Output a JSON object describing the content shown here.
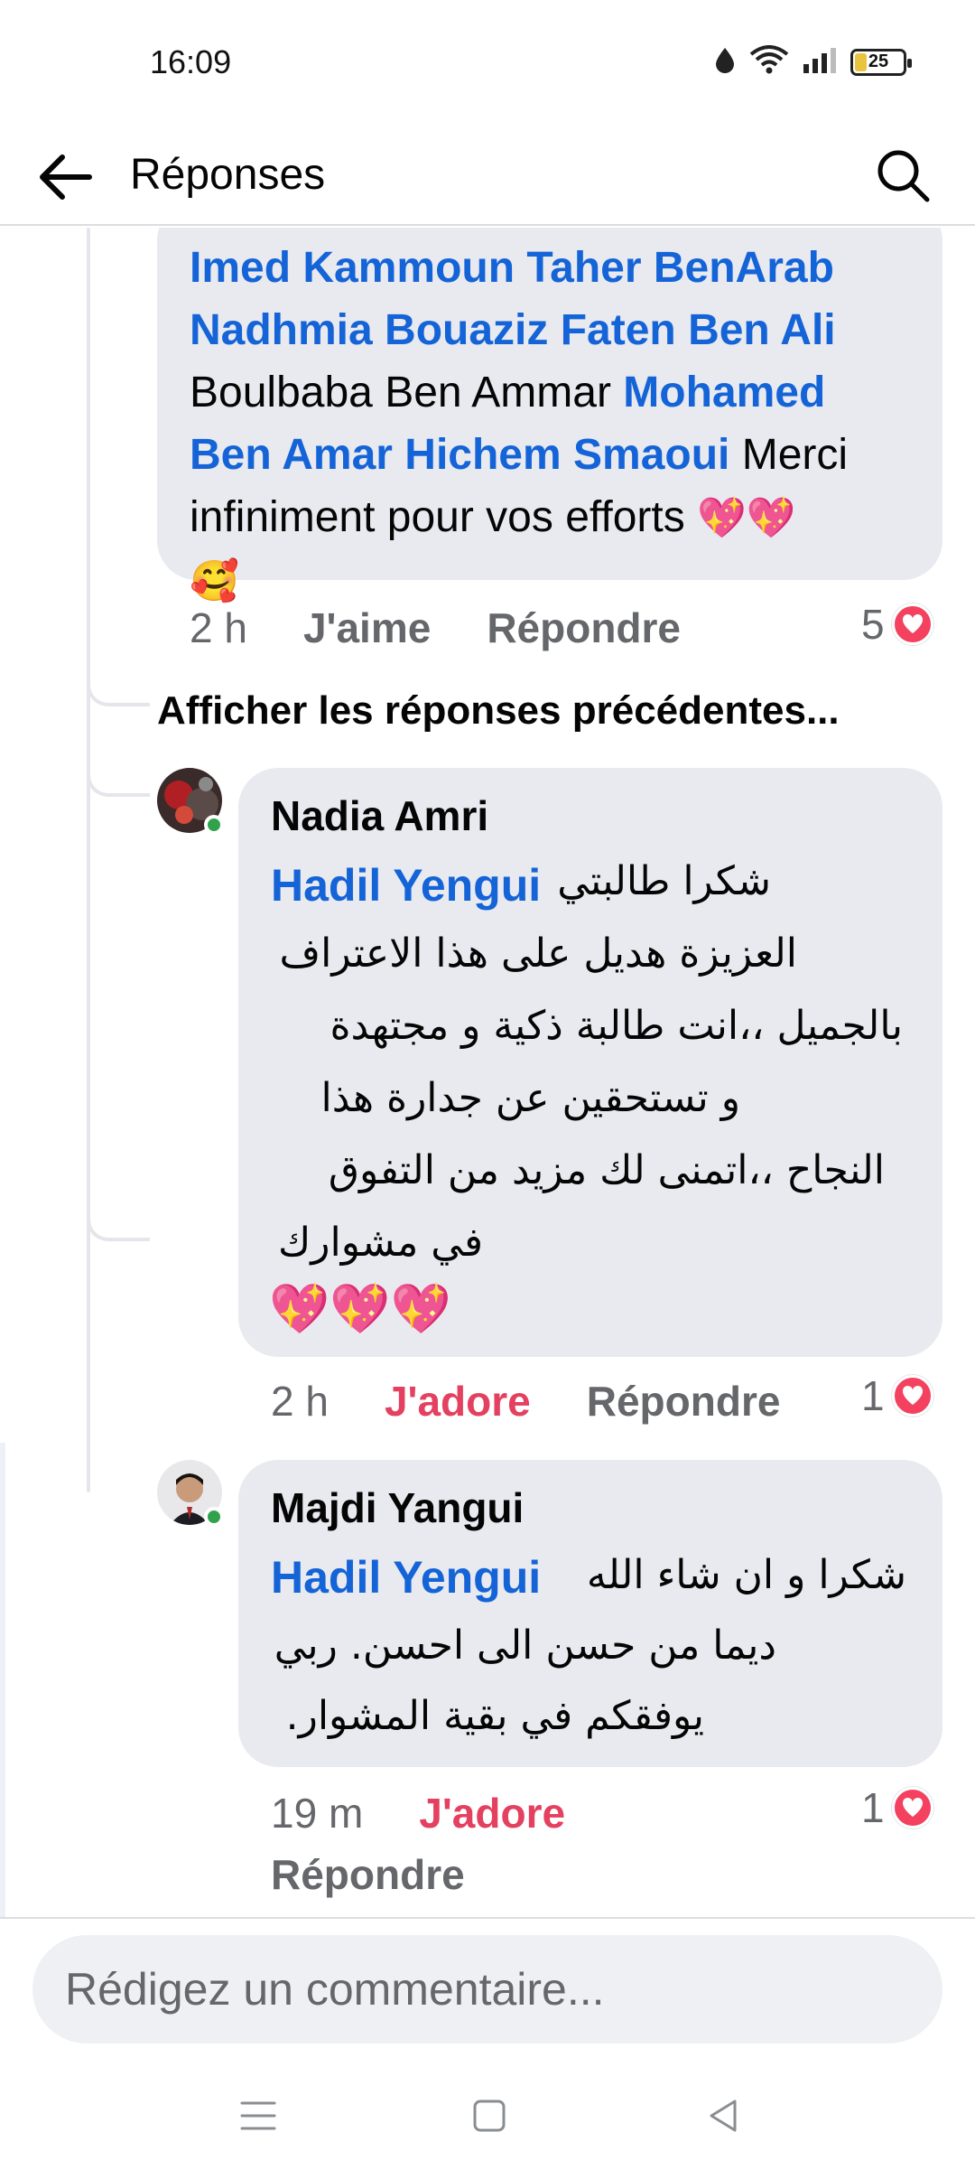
{
  "status_bar": {
    "time": "16:09",
    "battery": "25",
    "battery_level": 0.25
  },
  "app_bar": {
    "title": "Réponses",
    "back_icon": "arrow-left-icon",
    "search_icon": "search-icon"
  },
  "comment1": {
    "line1": "Imed Kammoun Taher BenArab",
    "line2": "Nadhmia Bouaziz Faten Ben Ali",
    "line3_plain": "Boulbaba Ben Ammar ",
    "line3_mention": "Mohamed",
    "line4_mention": "Ben Amar Hichem Smaoui",
    "line4_plain": " Merci",
    "line5": "infiniment pour vos efforts ",
    "emojis_line5": "💖💖",
    "emoji_line6": "🥰",
    "time": "2 h",
    "like": "J'aime",
    "reply": "Répondre",
    "reaction_count": "5"
  },
  "previous_replies": "Afficher les réponses précédentes...",
  "comment2": {
    "author": "Nadia Amri",
    "mention": "Hadil Yengui",
    "line1": "شكرا طالبتي",
    "line2": "العزيزة هديل على هذا الاعتراف",
    "line3": "بالجميل ،،انت طالبة ذكية و مجتهدة",
    "line4": "و تستحقين عن جدارة هذا",
    "line5": "النجاح ،،اتمنى لك مزيد من التفوق",
    "line6": "في مشوارك",
    "emojis": "💖💖💖",
    "time": "2 h",
    "reaction_label": "J'adore",
    "reply": "Répondre",
    "reaction_count": "1"
  },
  "comment3": {
    "author": "Majdi Yangui",
    "mention": "Hadil Yengui",
    "line1": "شكرا و ان شاء الله",
    "line2": "ديما من حسن الى احسن. ربي",
    "line3": "يوفقكم في بقية المشوار.",
    "time": "19 m",
    "reaction_label": "J'adore",
    "reply": "Répondre",
    "reaction_count": "1"
  },
  "composer": {
    "placeholder": "Rédigez un commentaire..."
  },
  "nav": {
    "menu_icon": "menu-icon",
    "home_icon": "home-square-icon",
    "back_icon": "back-triangle-icon"
  }
}
